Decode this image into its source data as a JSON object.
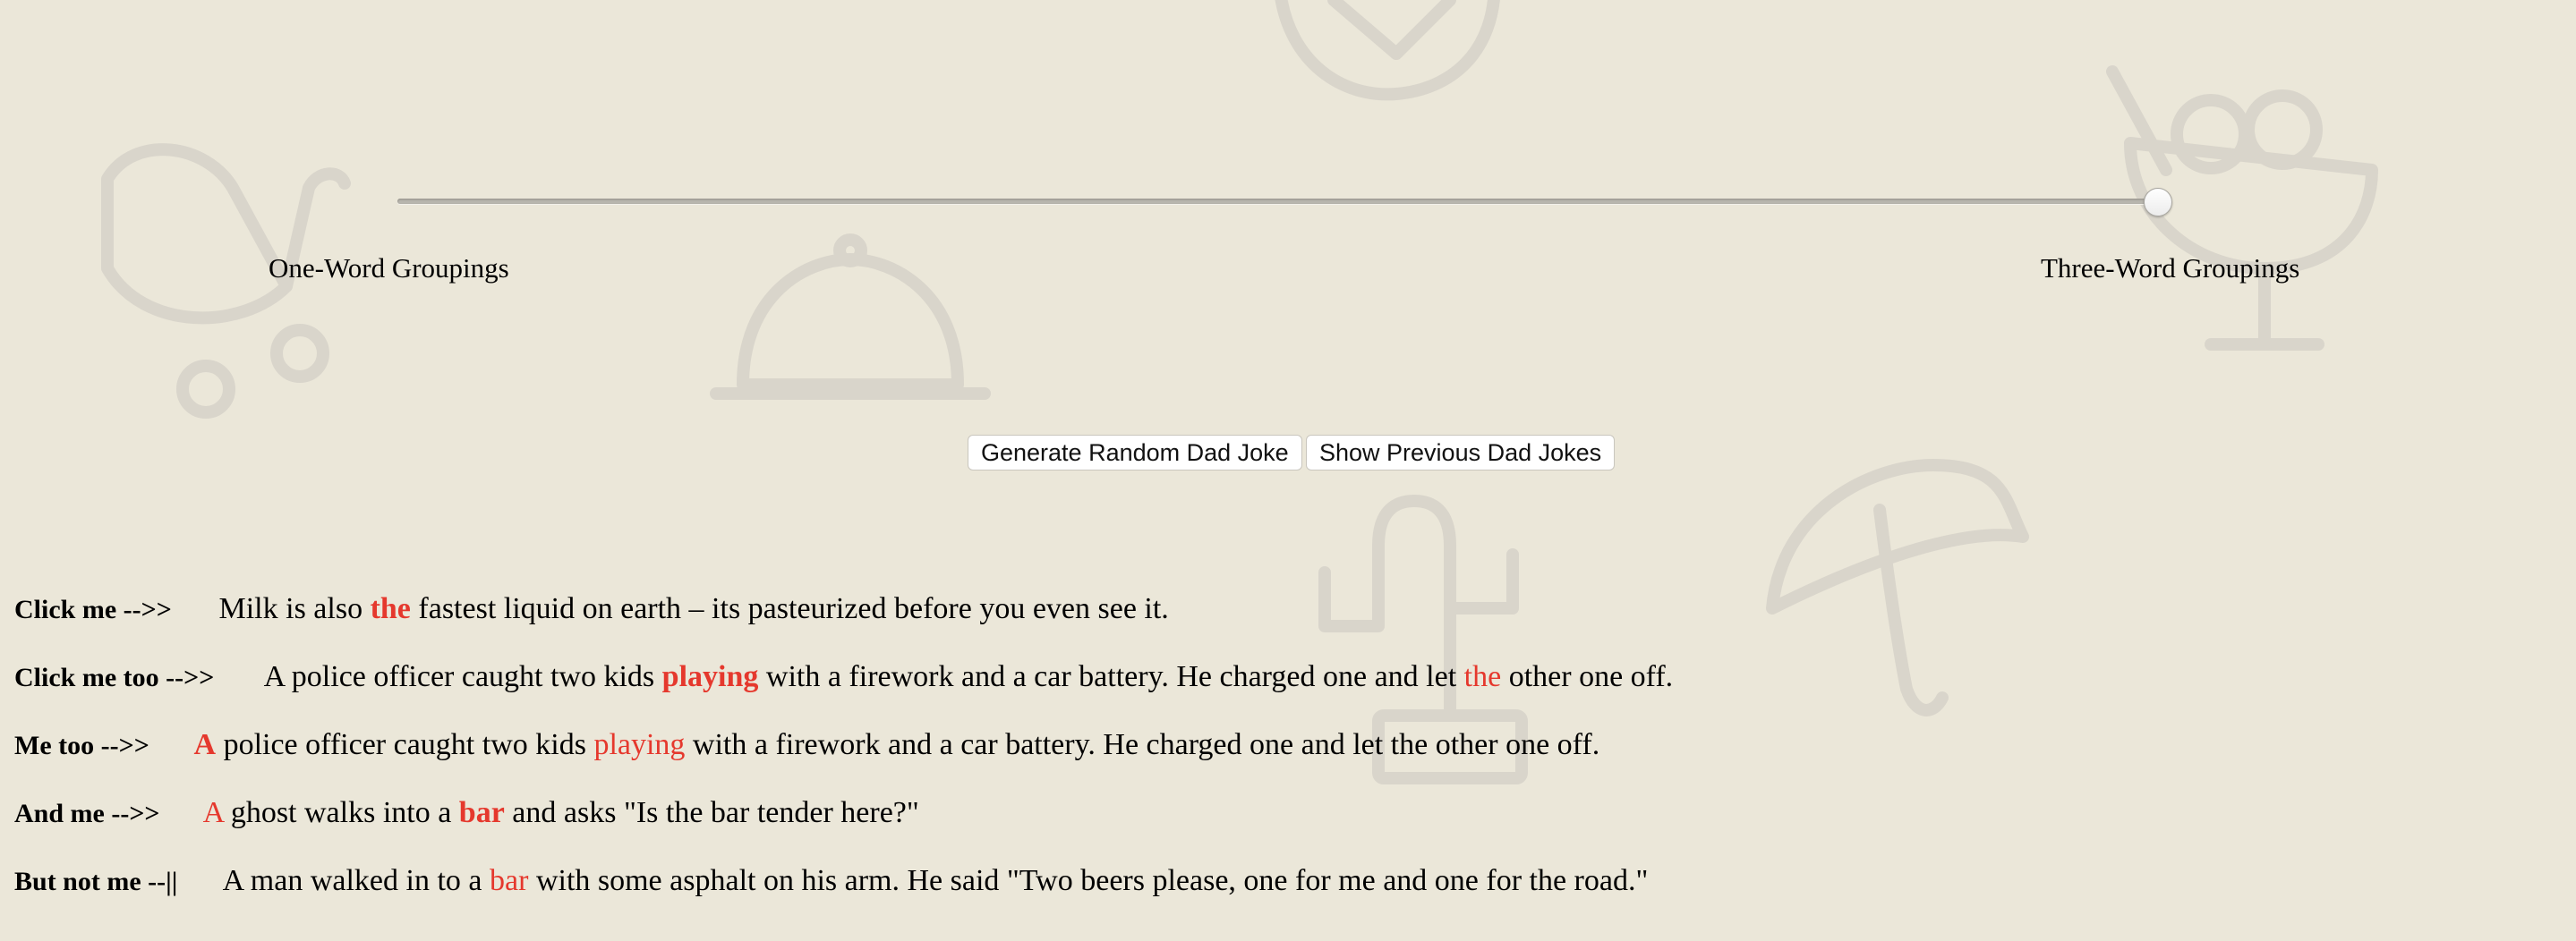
{
  "slider": {
    "value": 1.0,
    "min_label": "One-Word Groupings",
    "max_label": "Three-Word Groupings"
  },
  "buttons": {
    "generate": "Generate Random Dad Joke",
    "previous": "Show Previous Dad Jokes"
  },
  "colors": {
    "background": "#ebe7d9",
    "highlight": "#e5382d"
  },
  "jokes": [
    {
      "prefix": "Click me -->>",
      "segments": [
        {
          "text": "Milk is also ",
          "style": "plain"
        },
        {
          "text": "the",
          "style": "red-bold"
        },
        {
          "text": " fastest liquid on earth – its pasteurized before you even see it.",
          "style": "plain"
        }
      ]
    },
    {
      "prefix": "Click me too -->>",
      "segments": [
        {
          "text": "A police officer caught two kids ",
          "style": "plain"
        },
        {
          "text": "playing",
          "style": "red-bold"
        },
        {
          "text": " with a firework and a car battery. He charged one and let ",
          "style": "plain"
        },
        {
          "text": "the",
          "style": "red"
        },
        {
          "text": " other one off.",
          "style": "plain"
        }
      ]
    },
    {
      "prefix": "Me too -->>",
      "segments": [
        {
          "text": "A",
          "style": "red-bold"
        },
        {
          "text": " police officer caught two kids ",
          "style": "plain"
        },
        {
          "text": "playing",
          "style": "red"
        },
        {
          "text": " with a firework and a car battery. He charged one and let the other one off.",
          "style": "plain"
        }
      ]
    },
    {
      "prefix": "And me -->>",
      "segments": [
        {
          "text": "A",
          "style": "red"
        },
        {
          "text": " ghost walks into a ",
          "style": "plain"
        },
        {
          "text": "bar",
          "style": "red-bold"
        },
        {
          "text": " and asks \"Is the bar tender here?\"",
          "style": "plain"
        }
      ]
    },
    {
      "prefix": "But not me --||",
      "segments": [
        {
          "text": "A man walked in to a ",
          "style": "plain"
        },
        {
          "text": "bar",
          "style": "red"
        },
        {
          "text": " with some asphalt on his arm. He said \"Two beers please, one for me and one for the road.\"",
          "style": "plain"
        }
      ]
    }
  ]
}
